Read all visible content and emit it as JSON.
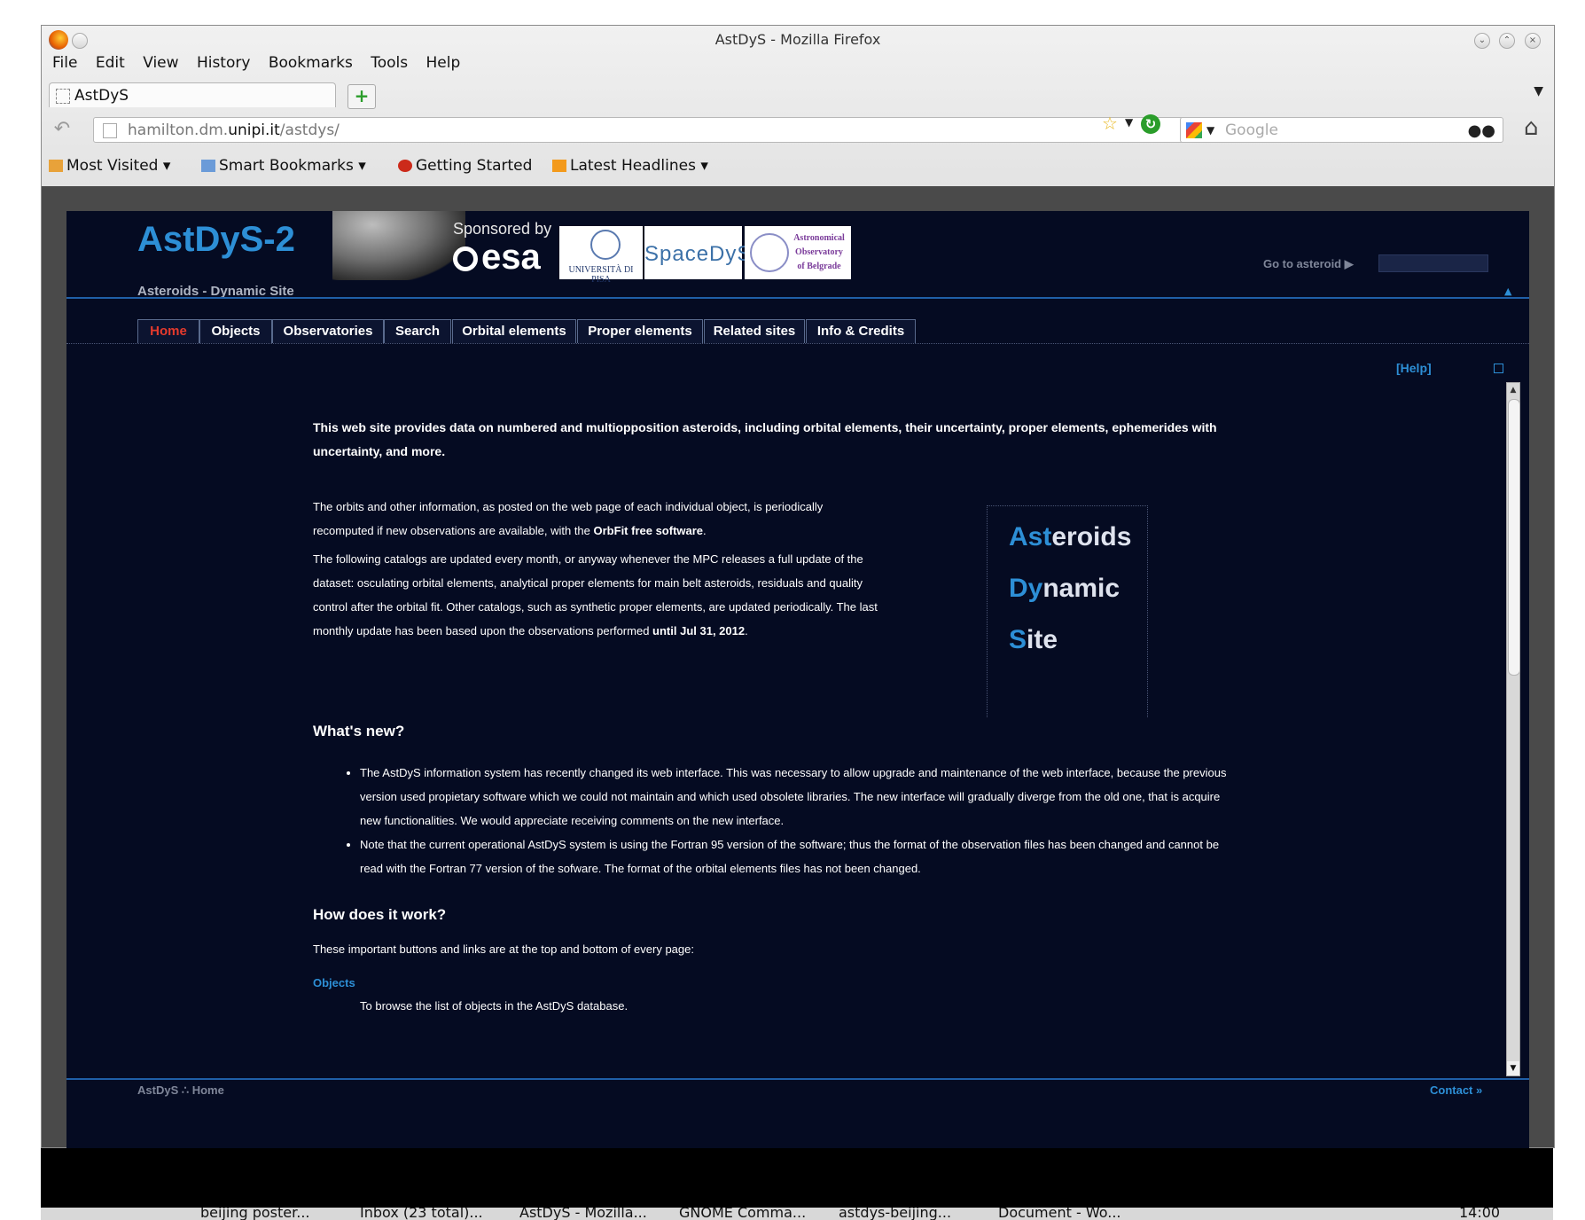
{
  "window": {
    "title": "AstDyS - Mozilla Firefox",
    "menu": [
      "File",
      "Edit",
      "View",
      "History",
      "Bookmarks",
      "Tools",
      "Help"
    ],
    "tab_label": "AstDyS",
    "url_prefix": "hamilton.dm.",
    "url_domain": "unipi.it",
    "url_path": "/astdys/",
    "search_placeholder": "Google",
    "bookmarks": [
      "Most Visited ▾",
      "Smart Bookmarks ▾",
      "Getting Started",
      "Latest Headlines ▾"
    ]
  },
  "site": {
    "logo": "AstDyS-2",
    "tagline": "Asteroids - Dynamic Site",
    "sponsored_by": "Sponsored by",
    "esa": "esa",
    "unipi": "UNIVERSITÀ DI PISA",
    "spacedys": "SpaceDyS",
    "belgrade": [
      "Astronomical",
      "Observatory",
      "of Belgrade"
    ],
    "goto_label": "Go to asteroid ▶",
    "nav": [
      "Home",
      "Objects",
      "Observatories",
      "Search",
      "Orbital elements",
      "Proper elements",
      "Related sites",
      "Info & Credits"
    ],
    "help": "[Help]"
  },
  "content": {
    "intro": "This web site provides data on numbered and multiopposition asteroids, including orbital elements, their uncertainty, proper elements, ephemerides with uncertainty, and more.",
    "p1_a": "The orbits and other information, as posted on the web page of each individual object, is periodically recomputed if new observations are available, with the ",
    "p1_link": "OrbFit free software",
    "p1_b": ".",
    "p2_a": "The following catalogs are updated every month, or anyway whenever the MPC releases a full update of the dataset: osculating orbital elements, analytical proper elements for main belt asteroids, residuals and quality control after the orbital fit. Other catalogs, such as synthetic proper elements, are updated periodically. The last monthly update has been based upon the observations performed ",
    "p2_bold": "until Jul 31, 2012",
    "p2_b": ".",
    "ads": [
      {
        "hl": "Ast",
        "rest": "eroids"
      },
      {
        "hl": "Dy",
        "rest": "namic"
      },
      {
        "hl": "S",
        "rest": "ite"
      }
    ],
    "whats_new_title": "What's new?",
    "whats_new": [
      "The AstDyS information system has recently changed its web interface. This was necessary to allow upgrade and maintenance of the web interface, because the previous version used propietary software which we could not maintain and which used obsolete libraries. The new interface will gradually diverge from the old one, that is acquire new functionalities. We would appreciate receiving comments on the new interface.",
      "Note that the current operational AstDyS system is using the Fortran 95 version of the software; thus the format of the observation files has been changed and cannot be read with the Fortran 77 version of the sofware. The format of the orbital elements files has not been changed."
    ],
    "how_title": "How does it work?",
    "how_text": "These important buttons and links are at the top and bottom of every page:",
    "objects_link": "Objects",
    "objects_desc": "To browse the list of objects in the AstDyS database."
  },
  "footer": {
    "left": "AstDyS ∴ Home",
    "right": "Contact »"
  },
  "taskbar": [
    "beijing poster...",
    "Inbox (23 total)...",
    "AstDyS - Mozilla...",
    "GNOME Comma...",
    "astdys-beijing...",
    "Document - Wo...",
    "14:00"
  ]
}
